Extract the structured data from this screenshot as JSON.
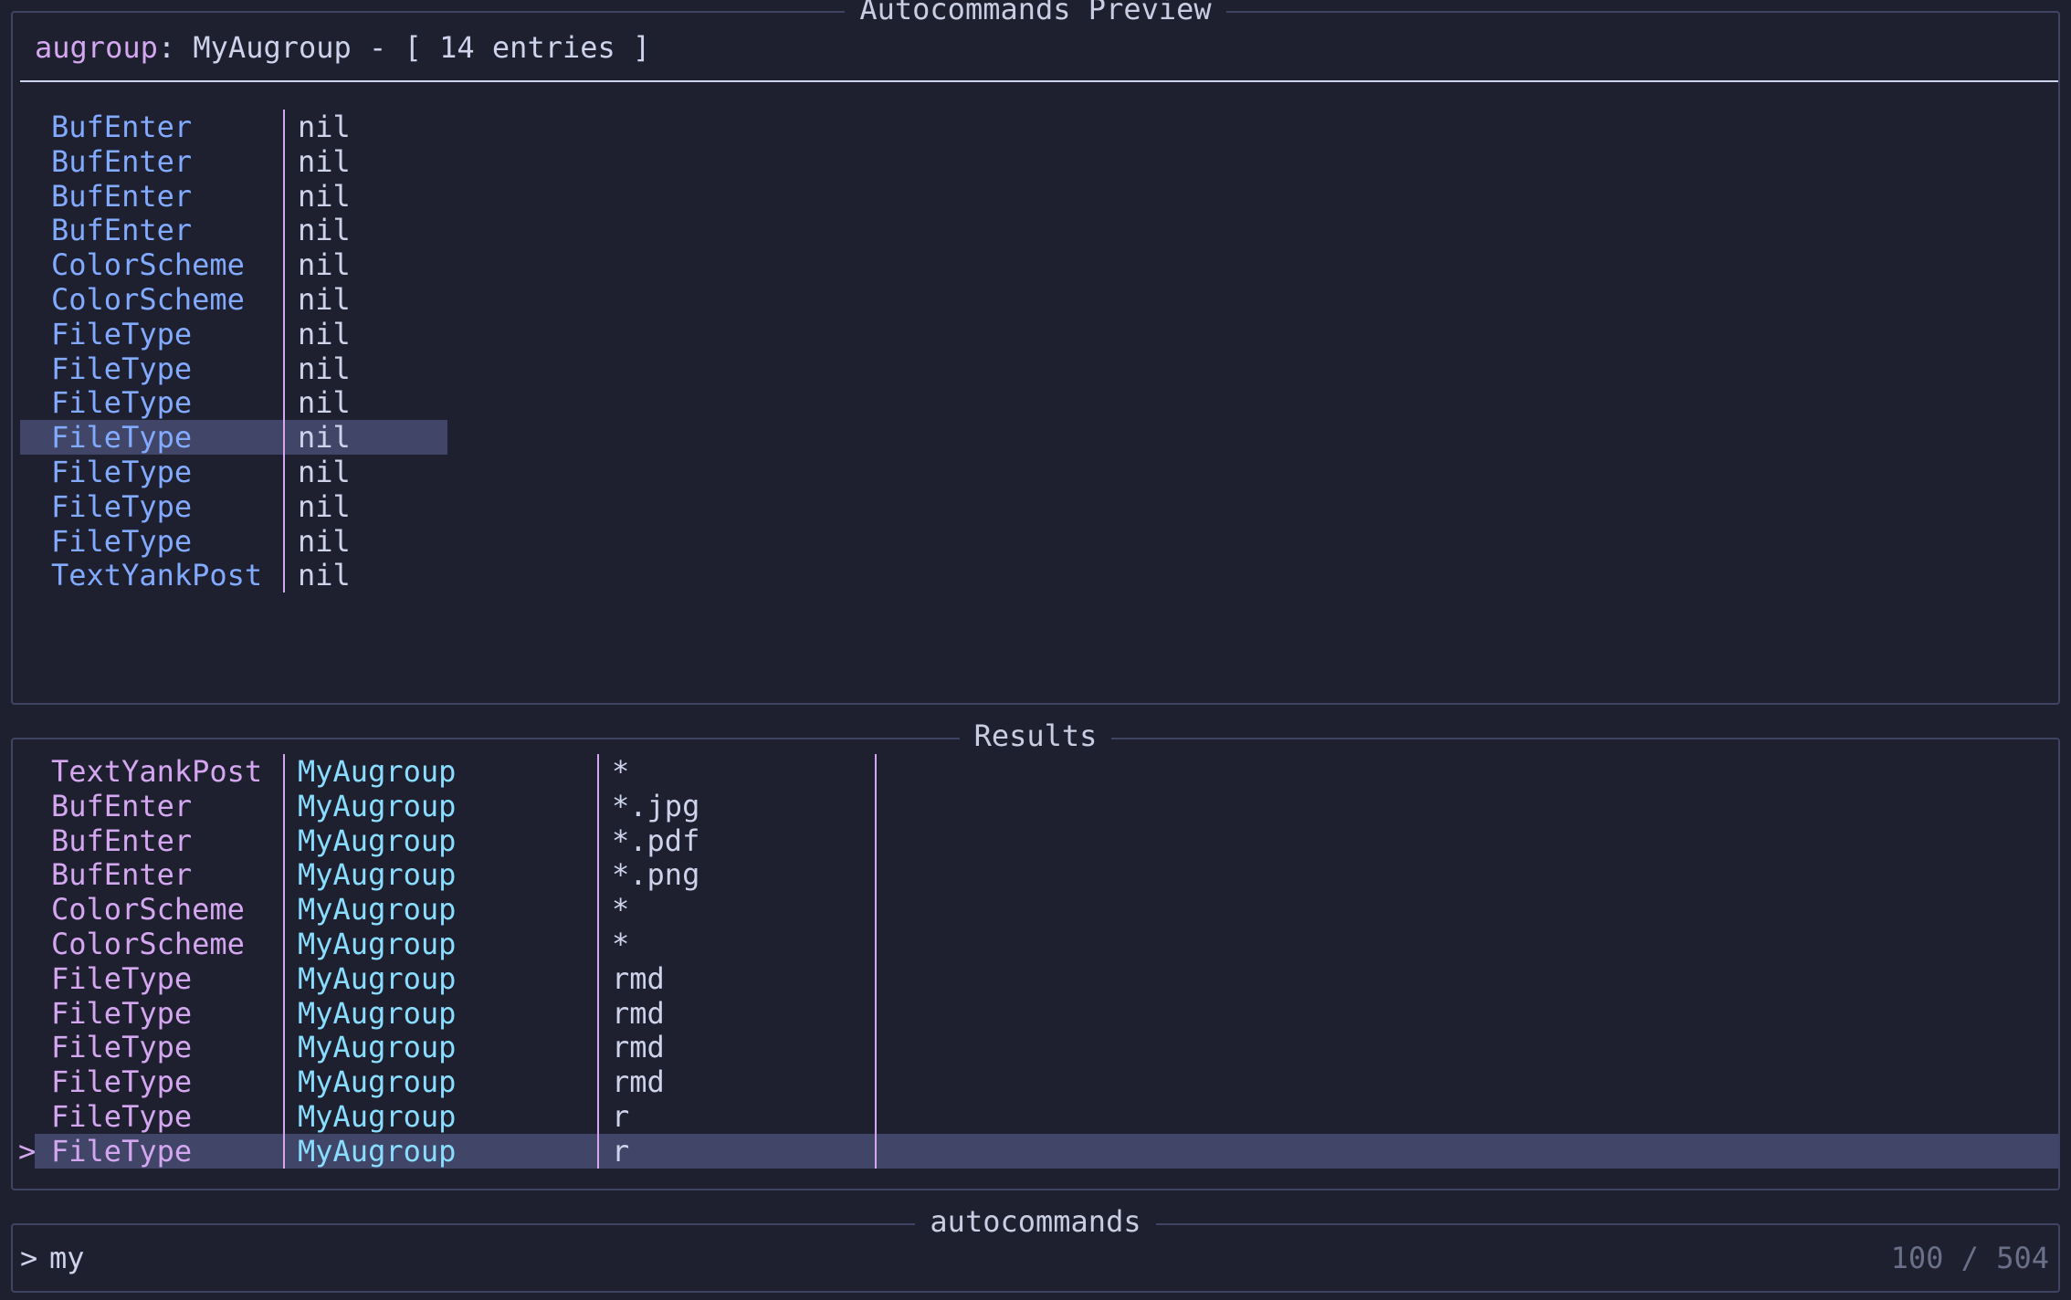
{
  "preview": {
    "title": "Autocommands Preview",
    "header_key": "augroup",
    "header_rest": ": MyAugroup - [ 14 entries ]",
    "rows": [
      {
        "event": "BufEnter",
        "value": "nil"
      },
      {
        "event": "BufEnter",
        "value": "nil"
      },
      {
        "event": "BufEnter",
        "value": "nil"
      },
      {
        "event": "BufEnter",
        "value": "nil"
      },
      {
        "event": "ColorScheme",
        "value": "nil"
      },
      {
        "event": "ColorScheme",
        "value": "nil"
      },
      {
        "event": "FileType",
        "value": "nil"
      },
      {
        "event": "FileType",
        "value": "nil"
      },
      {
        "event": "FileType",
        "value": "nil"
      },
      {
        "event": "FileType",
        "value": "nil",
        "selected": true
      },
      {
        "event": "FileType",
        "value": "nil"
      },
      {
        "event": "FileType",
        "value": "nil"
      },
      {
        "event": "FileType",
        "value": "nil"
      },
      {
        "event": "TextYankPost",
        "value": "nil"
      }
    ]
  },
  "results": {
    "title": "Results",
    "caret": ">",
    "rows": [
      {
        "event": "TextYankPost",
        "group": "MyAugroup",
        "pattern": "*"
      },
      {
        "event": "BufEnter",
        "group": "MyAugroup",
        "pattern": "*.jpg"
      },
      {
        "event": "BufEnter",
        "group": "MyAugroup",
        "pattern": "*.pdf"
      },
      {
        "event": "BufEnter",
        "group": "MyAugroup",
        "pattern": "*.png"
      },
      {
        "event": "ColorScheme",
        "group": "MyAugroup",
        "pattern": "*"
      },
      {
        "event": "ColorScheme",
        "group": "MyAugroup",
        "pattern": "*"
      },
      {
        "event": "FileType",
        "group": "MyAugroup",
        "pattern": "rmd"
      },
      {
        "event": "FileType",
        "group": "MyAugroup",
        "pattern": "rmd"
      },
      {
        "event": "FileType",
        "group": "MyAugroup",
        "pattern": "rmd"
      },
      {
        "event": "FileType",
        "group": "MyAugroup",
        "pattern": "rmd"
      },
      {
        "event": "FileType",
        "group": "MyAugroup",
        "pattern": "r"
      },
      {
        "event": "FileType",
        "group": "MyAugroup",
        "pattern": "r",
        "selected": true
      }
    ]
  },
  "prompt": {
    "title": "autocommands",
    "prefix": ">",
    "value": "my",
    "count": "100 / 504"
  },
  "colors": {
    "background": "#1e2030",
    "border": "#3f4462",
    "selection": "#414668",
    "event_preview": "#82aaff",
    "event_results": "#d4a7f0",
    "group": "#89ddff",
    "text": "#cdd3ea",
    "muted": "#6b7089"
  }
}
